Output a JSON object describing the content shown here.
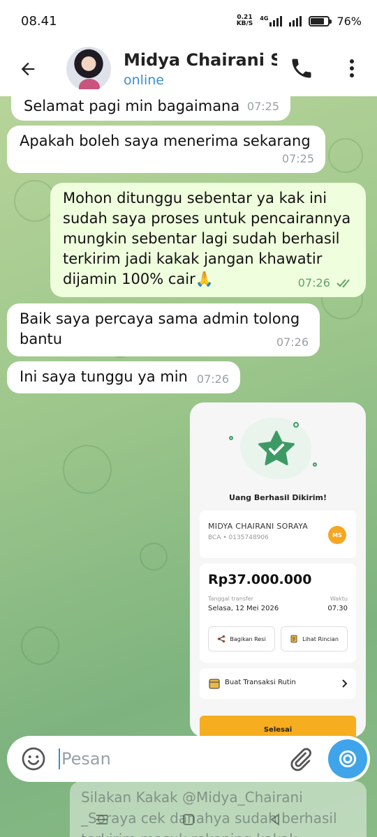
{
  "status_bar": {
    "time": "08.41",
    "net_speed_value": "0.21",
    "net_speed_unit": "KB/S",
    "network": "4G",
    "battery": "76%"
  },
  "header": {
    "contact_name": "Midya Chairani Soraya",
    "contact_status": "online",
    "icons": [
      "back-arrow-icon",
      "avatar",
      "phone-icon",
      "more-vert-icon"
    ]
  },
  "messages": [
    {
      "direction": "in",
      "text": "Selamat pagi min bagaimana",
      "time": "07:25"
    },
    {
      "direction": "in",
      "text": "Apakah boleh saya menerima sekarang",
      "time": "07:25"
    },
    {
      "direction": "out",
      "text": "Mohon ditunggu sebentar ya kak ini sudah saya proses untuk pencairannya mungkin sebentar lagi sudah berhasil terkirim jadi kakak jangan khawatir dijamin 100% cair🙏",
      "time": "07:26",
      "read": true
    },
    {
      "direction": "in",
      "text": "Baik saya percaya sama admin tolong bantu",
      "time": "07:26"
    },
    {
      "direction": "in",
      "text": "Ini saya tunggu ya min",
      "time": "07:26"
    }
  ],
  "receipt": {
    "title": "Uang Berhasil Dikirim!",
    "recipient_name": "MIDYA CHAIRANI SORAYA",
    "recipient_account": "BCA • 0135748906",
    "recipient_initials": "MS",
    "amount": "Rp37.000.000",
    "date_label": "Tanggal transfer",
    "date_value": "Selasa, 12 Mei 2026",
    "time_label": "Waktu",
    "time_value": "07.30",
    "share_label": "Bagikan Resi",
    "details_label": "Lihat Rincian",
    "recurring_label": "Buat Transaksi Rutin",
    "done_label": "Selesai",
    "accent_color": "#3e9a64"
  },
  "ghost_message": {
    "line1": "Silakan Kakak @Midya_Chairani",
    "line2": "_Soraya cek danahya sudah berhasil",
    "line3": "terkirim masuk rekening kakak"
  },
  "input": {
    "placeholder": "Pesan"
  },
  "colors": {
    "accent": "#3a8fd0",
    "outgoing_bubble": "#effedd",
    "camera_button": "#3fa4ea"
  }
}
